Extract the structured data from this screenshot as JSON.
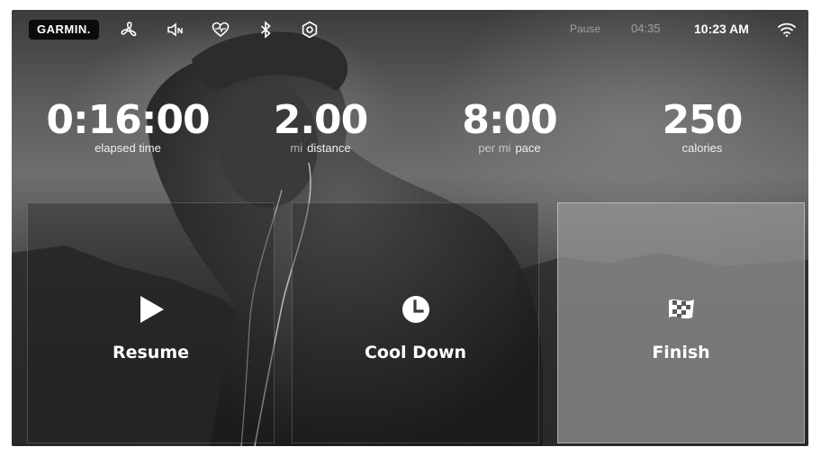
{
  "topbar": {
    "logo": "GARMIN.",
    "icons": [
      "fan-icon",
      "volume-icon",
      "heart-rate-icon",
      "bluetooth-icon",
      "settings-icon"
    ],
    "pause_label": "Pause",
    "pause_timer": "04:35",
    "clock": "10:23 AM",
    "wifi_icon": "wifi-icon"
  },
  "metrics": {
    "elapsed": {
      "value": "0:16:00",
      "label": "elapsed time"
    },
    "distance": {
      "value": "2.00",
      "unit": "mi",
      "label": "distance"
    },
    "pace": {
      "value": "8:00",
      "unit": "per mi",
      "label": "pace"
    },
    "calories": {
      "value": "250",
      "label": "calories"
    }
  },
  "actions": {
    "resume": {
      "label": "Resume",
      "icon": "play-icon"
    },
    "cooldown": {
      "label": "Cool Down",
      "icon": "clock-icon"
    },
    "finish": {
      "label": "Finish",
      "icon": "checkered-flag-icon",
      "selected": true
    }
  },
  "colors": {
    "text": "#ffffff",
    "logo_bg": "#0b0b0b",
    "selected_panel": "#969696"
  }
}
